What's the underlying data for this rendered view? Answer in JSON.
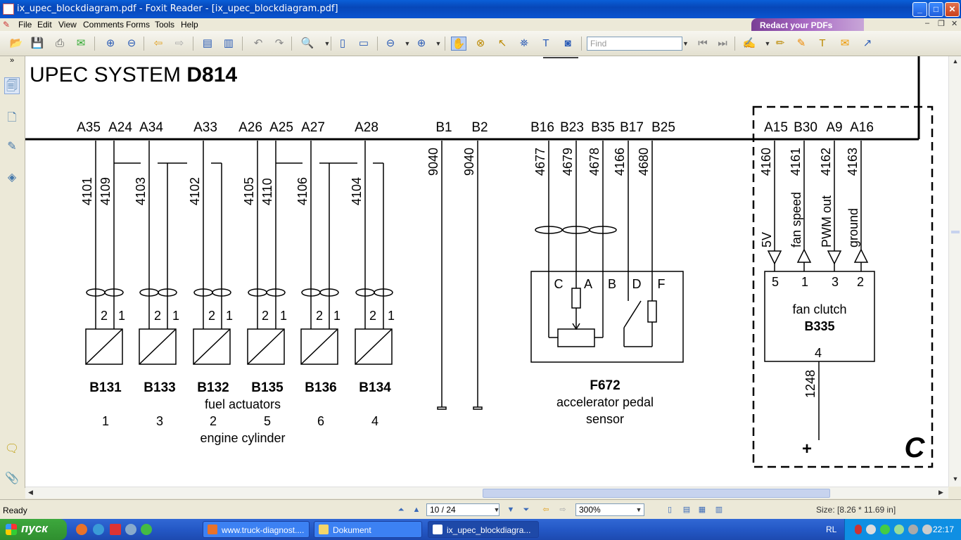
{
  "window": {
    "title": "ix_upec_blockdiagram.pdf - Foxit Reader - [ix_upec_blockdiagram.pdf]",
    "min": "_",
    "max": "□",
    "close": "✕"
  },
  "menu": {
    "items": [
      "File",
      "Edit",
      "View",
      "Comments",
      "Forms",
      "Tools",
      "Help"
    ]
  },
  "redact_banner": "Redact your PDFs",
  "toolbar": {
    "find_placeholder": "Find"
  },
  "diagram": {
    "title_prefix": "UPEC SYSTEM ",
    "title_code": "D814",
    "connectors": [
      "A35",
      "A24",
      "A34",
      "A33",
      "A26",
      "A25",
      "A27",
      "A28",
      "B1",
      "B2",
      "B16",
      "B23",
      "B35",
      "B17",
      "B25",
      "A15",
      "B30",
      "A9",
      "A16"
    ],
    "wires_injectors": [
      "4101",
      "4109",
      "4103",
      "4102",
      "4105",
      "4110",
      "4106",
      "4104"
    ],
    "pin_labels": [
      "2",
      "1"
    ],
    "actuators": [
      "B131",
      "B133",
      "B132",
      "B135",
      "B136",
      "B134"
    ],
    "cylinders": [
      "1",
      "3",
      "2",
      "5",
      "6",
      "4"
    ],
    "fuel_actuators_label": "fuel actuators",
    "engine_cylinder_label": "engine cylinder",
    "ground_wires": [
      "9040",
      "9040"
    ],
    "pedal_wires": [
      "4677",
      "4679",
      "4678",
      "4166",
      "4680"
    ],
    "pedal_pins": [
      "C",
      "A",
      "B",
      "D",
      "F"
    ],
    "pedal_code": "F672",
    "pedal_name_1": "accelerator pedal",
    "pedal_name_2": "sensor",
    "fan_wires": [
      "4160",
      "4161",
      "4162",
      "4163"
    ],
    "fan_signals": [
      "5V",
      "fan speed",
      "PWM out",
      "ground"
    ],
    "fan_pins": [
      "5",
      "1",
      "3",
      "2"
    ],
    "fan_name": "fan clutch",
    "fan_code": "B335",
    "fan_pin_out": "4",
    "fan_supply_wire": "1248",
    "plus": "+",
    "section_letter": "C"
  },
  "status": {
    "ready": "Ready",
    "page": "10 / 24",
    "zoom": "300%",
    "size": "Size: [8.26 * 11.69 in]"
  },
  "taskbar": {
    "start": "пуск",
    "tasks": [
      "www.truck-diagnost....",
      "Dokument",
      "ix_upec_blockdiagra..."
    ],
    "lang": "RL",
    "clock": "22:17"
  }
}
